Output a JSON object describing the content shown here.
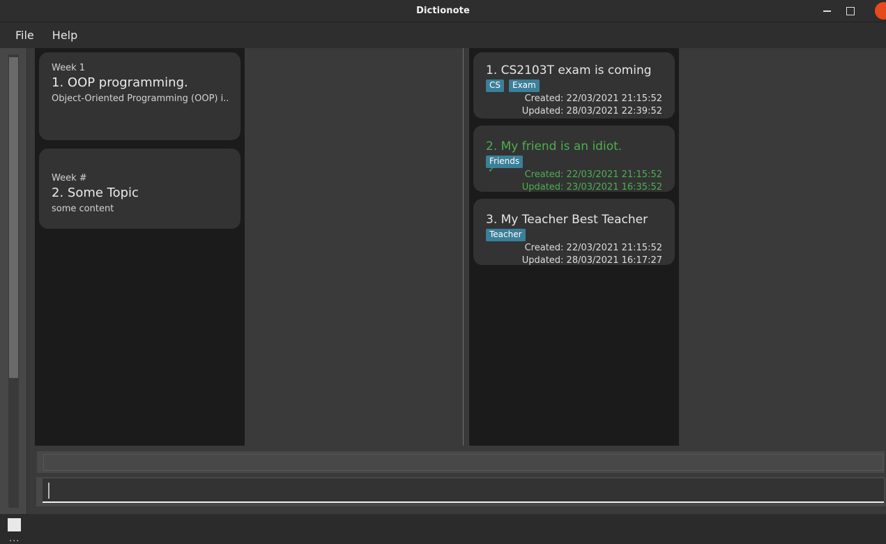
{
  "window": {
    "title": "Dictionote",
    "controls": {
      "minimize": "minimize-button",
      "maximize": "maximize-button",
      "close": "close-button"
    }
  },
  "menubar": {
    "items": [
      {
        "label": "File"
      },
      {
        "label": "Help"
      }
    ]
  },
  "left_panel": {
    "cards": [
      {
        "week": "Week 1",
        "title": "1.  OOP programming.",
        "body": "Object-Oriented Programming (OOP) i..."
      },
      {
        "week": "Week #",
        "title": "2.  Some Topic",
        "body": "some content"
      }
    ]
  },
  "right_panel": {
    "notes": [
      {
        "title": "1.  CS2103T exam is coming",
        "tags": [
          "CS",
          "Exam"
        ],
        "created": "Created: 22/03/2021 21:15:52",
        "updated": "Updated: 28/03/2021 22:39:52",
        "done": false,
        "check": ""
      },
      {
        "title": "2.  My friend is an idiot.",
        "tags": [
          "Friends"
        ],
        "created": "Created: 22/03/2021 21:15:52",
        "updated": "Updated: 23/03/2021 16:35:52",
        "done": true,
        "check": "✓"
      },
      {
        "title": "3.  My Teacher Best Teacher",
        "tags": [
          "Teacher"
        ],
        "created": "Created: 22/03/2021 21:15:52",
        "updated": "Updated: 28/03/2021 16:17:27",
        "done": false,
        "check": ""
      }
    ]
  },
  "bottom": {
    "result_display_value": "",
    "command_input_value": "",
    "command_input_placeholder": ""
  },
  "left_strip": {
    "overflow_dots": "..."
  },
  "colors": {
    "window_bg": "#2e2e2e",
    "panel_bg": "#3a3a3a",
    "list_bg": "#1b1b1b",
    "card_bg": "#333333",
    "tag_bg": "#3b7f99",
    "done_green": "#4caf4f",
    "close_button": "#e8491c",
    "text_primary": "#e6e6e6"
  }
}
